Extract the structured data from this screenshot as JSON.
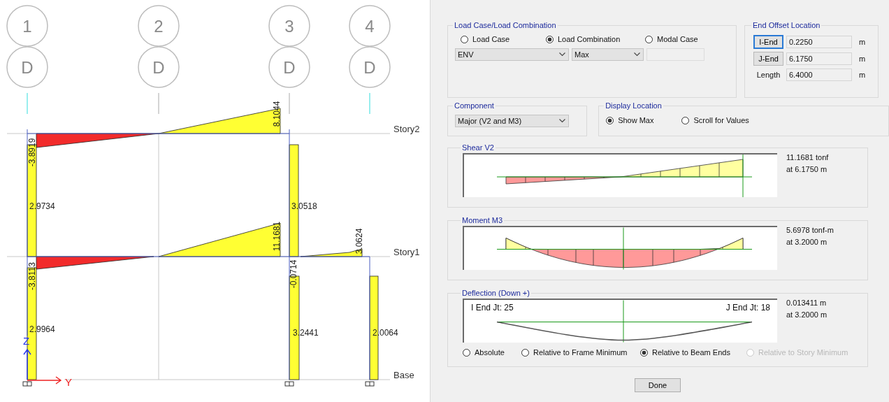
{
  "elevation": {
    "grid_lines": [
      {
        "label": "1",
        "bubble": "D"
      },
      {
        "label": "2",
        "bubble": "D"
      },
      {
        "label": "3",
        "bubble": "D"
      },
      {
        "label": "4",
        "bubble": "D"
      }
    ],
    "stories": [
      {
        "name": "Story2"
      },
      {
        "name": "Story1"
      },
      {
        "name": "Base"
      }
    ],
    "values": [
      "8.1044",
      "-3.8919",
      "2.9734",
      "3.0518",
      "11.1681",
      "3.0624",
      "-3.8113",
      "-0.0714",
      "2.9964",
      "3.2441",
      "2.0064"
    ],
    "axes": {
      "vertical": "Z",
      "horizontal": "Y"
    }
  },
  "dialog": {
    "load_group": {
      "title": "Load Case/Load Combination",
      "options": [
        {
          "label": "Load Case",
          "selected": false
        },
        {
          "label": "Load Combination",
          "selected": true
        },
        {
          "label": "Modal Case",
          "selected": false
        }
      ],
      "case_dropdown": "ENV",
      "type_dropdown": "Max"
    },
    "end_offset": {
      "title": "End Offset Location",
      "rows": [
        {
          "kind": "button",
          "label": "I-End",
          "focused": true,
          "value": "0.2250",
          "unit": "m"
        },
        {
          "kind": "button",
          "label": "J-End",
          "focused": false,
          "value": "6.1750",
          "unit": "m"
        },
        {
          "kind": "label",
          "label": "Length",
          "value": "6.4000",
          "unit": "m"
        }
      ]
    },
    "component": {
      "title": "Component",
      "value": "Major (V2 and M3)"
    },
    "display_location": {
      "title": "Display Location",
      "options": [
        {
          "label": "Show Max",
          "selected": true
        },
        {
          "label": "Scroll for Values",
          "selected": false
        }
      ]
    },
    "shear": {
      "title": "Shear V2",
      "readings": [
        "11.1681 tonf",
        "at 6.1750 m"
      ]
    },
    "moment": {
      "title": "Moment M3",
      "readings": [
        "5.6978 tonf-m",
        "at 3.2000 m"
      ]
    },
    "deflection": {
      "title": "Deflection (Down +)",
      "i_end": "I End Jt: 25",
      "j_end": "J End Jt: 18",
      "readings": [
        "0.013411 m",
        "at 3.2000 m"
      ],
      "options": [
        {
          "label": "Absolute",
          "selected": false,
          "disabled": false
        },
        {
          "label": "Relative to Frame Minimum",
          "selected": false,
          "disabled": false
        },
        {
          "label": "Relative to Beam Ends",
          "selected": true,
          "disabled": false
        },
        {
          "label": "Relative to Story Minimum",
          "selected": false,
          "disabled": true
        }
      ]
    },
    "done_button": "Done"
  }
}
